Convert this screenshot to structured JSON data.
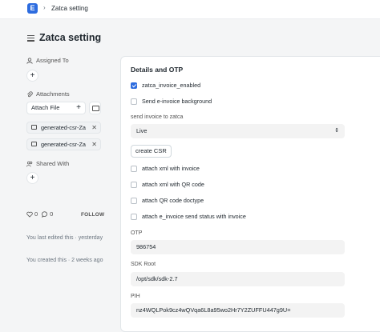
{
  "topbar": {
    "logo_letter": "E",
    "breadcrumb_sep": "›",
    "breadcrumb": "Zatca setting"
  },
  "page": {
    "title": "Zatca setting"
  },
  "sidebar": {
    "assigned_to": "Assigned To",
    "attachments": "Attachments",
    "attach_file": "Attach File",
    "files": [
      "generated-csr-Za",
      "generated-csr-Za"
    ],
    "shared_with": "Shared With",
    "likes": "0",
    "comments": "0",
    "follow": "FOLLOW",
    "last_edited": "You last edited this · yesterday",
    "created": "You created this · 2 weeks ago"
  },
  "form": {
    "section_title": "Details and OTP",
    "zatca_invoice_enabled": {
      "label": "zatca_invoice_enabled",
      "checked": true
    },
    "send_background": {
      "label": "Send e-invoice background",
      "checked": false
    },
    "send_invoice_to_zatca": {
      "label": "send invoice to zatca",
      "value": "Live"
    },
    "create_csr": "create CSR",
    "attach_xml": {
      "label": "attach xml with invoice",
      "checked": false
    },
    "attach_xml_qr": {
      "label": "attach xml with QR code",
      "checked": false
    },
    "attach_qr_doctype": {
      "label": "attach QR code doctype",
      "checked": false
    },
    "attach_status": {
      "label": "attach e_invoice send status with invoice",
      "checked": false
    },
    "otp": {
      "label": "OTP",
      "value": "986754"
    },
    "sdk_root": {
      "label": "SDK Root",
      "value": "/opt/sdk/sdk-2.7"
    },
    "pih": {
      "label": "PIH",
      "value": "nz4WQLPok9cz4wQVqa6L8a95wo2Hr7Y2ZUFFU447g9U="
    }
  },
  "colors": {
    "accent": "#2d6cdf",
    "field_bg": "#f3f3f3",
    "page_bg": "#f4f5f6"
  }
}
